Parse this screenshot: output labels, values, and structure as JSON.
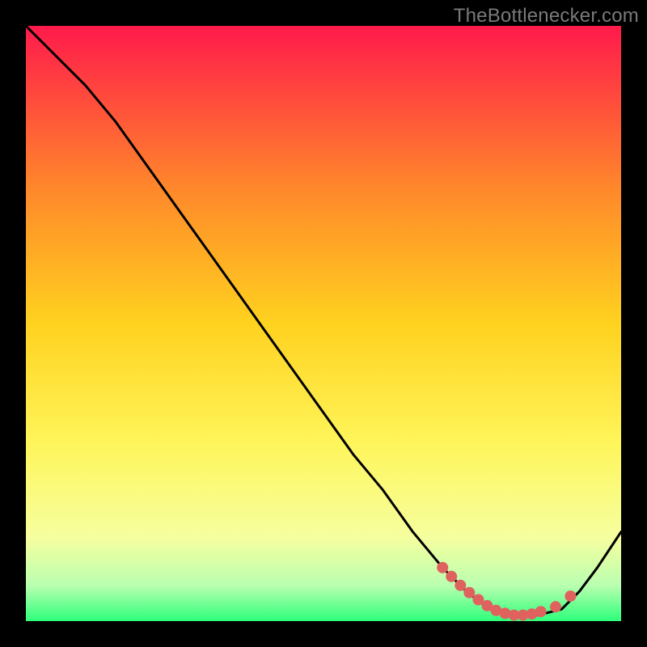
{
  "attribution": "TheBottlenecker.com",
  "colors": {
    "gradient_top": "#ff1a4b",
    "gradient_mid_upper": "#ff8a2a",
    "gradient_mid": "#ffd21f",
    "gradient_mid_lower": "#fff55a",
    "gradient_bottom_fade": "#f6ff9f",
    "gradient_near_bottom": "#baffb0",
    "gradient_bottom": "#2dff7a",
    "curve": "#000000",
    "marker": "#e0625f",
    "frame": "#000000",
    "attribution_text": "#7a7a7a"
  },
  "chart_data": {
    "type": "line",
    "title": "",
    "xlabel": "",
    "ylabel": "",
    "xlim": [
      0,
      100
    ],
    "ylim": [
      0,
      100
    ],
    "grid": false,
    "legend": false,
    "series": [
      {
        "name": "bottleneck-curve",
        "x": [
          0,
          3,
          6,
          10,
          15,
          20,
          25,
          30,
          35,
          40,
          45,
          50,
          55,
          60,
          65,
          70,
          74,
          78,
          82,
          86,
          90,
          93,
          96,
          100
        ],
        "y": [
          100,
          97,
          94,
          90,
          84,
          77,
          70,
          63,
          56,
          49,
          42,
          35,
          28,
          22,
          15,
          9,
          5,
          2,
          1,
          1,
          2,
          5,
          9,
          15
        ]
      }
    ],
    "markers": {
      "name": "highlight-points",
      "x": [
        70,
        71.5,
        73,
        74.5,
        76,
        77.5,
        79,
        80.5,
        82,
        83.5,
        85,
        86.5,
        89,
        91.5
      ],
      "y": [
        9,
        7.5,
        6,
        4.8,
        3.6,
        2.6,
        1.8,
        1.3,
        1.0,
        1.0,
        1.2,
        1.6,
        2.4,
        4.2
      ]
    }
  }
}
